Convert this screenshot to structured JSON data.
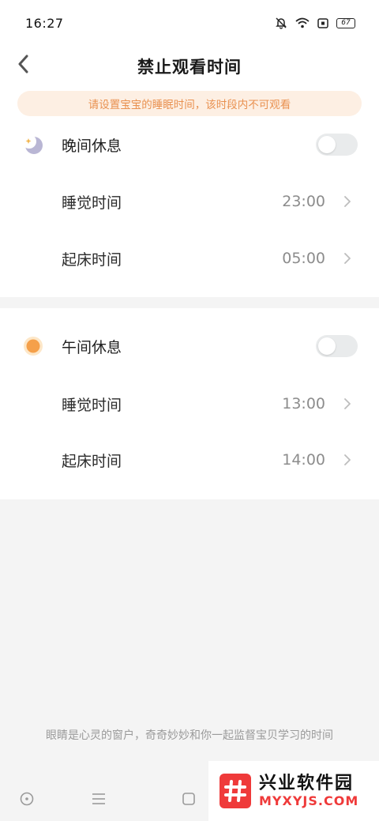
{
  "status_bar": {
    "time": "16:27",
    "battery": "67",
    "icons": [
      "mute-bell-icon",
      "wifi-icon",
      "sim-icon",
      "battery-icon"
    ]
  },
  "header": {
    "title": "禁止观看时间",
    "back_icon": "chevron-left-icon"
  },
  "notice": {
    "text": "请设置宝宝的睡眠时间，该时段内不可观看",
    "color": "#e99150",
    "background": "#fdefe3"
  },
  "night": {
    "label": "晚间休息",
    "icon": "moon-star-icon",
    "enabled": false,
    "sleep_label": "睡觉时间",
    "sleep_time": "23:00",
    "wake_label": "起床时间",
    "wake_time": "05:00"
  },
  "noon": {
    "label": "午间休息",
    "icon": "sun-icon",
    "enabled": false,
    "sleep_label": "睡觉时间",
    "sleep_time": "13:00",
    "wake_label": "起床时间",
    "wake_time": "14:00"
  },
  "footer": {
    "text": "眼睛是心灵的窗户，奇奇妙妙和你一起监督宝贝学习的时间"
  },
  "bottom_nav": {
    "icons": [
      "circle-nav-icon",
      "menu-nav-icon",
      "square-nav-icon"
    ]
  },
  "watermark": {
    "logo_symbol": "#",
    "title": "兴业软件园",
    "domain": "MYXYJS.COM"
  },
  "colors": {
    "accent": "#e99150",
    "toggle_off": "#e9ebec",
    "value_gray": "#8c8c8c",
    "watermark_red": "#ef3a3a"
  }
}
